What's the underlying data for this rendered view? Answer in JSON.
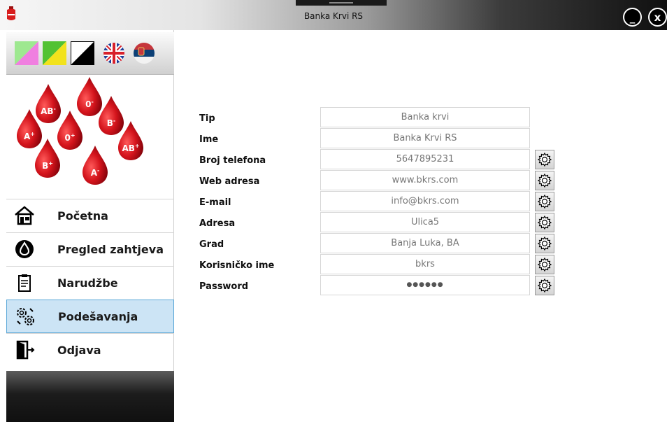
{
  "window": {
    "title": "Banka Krvi RS",
    "minimize_label": "_",
    "close_label": "x"
  },
  "themes": [
    {
      "name": "pink-green-theme",
      "colors": [
        "#f07fe0",
        "#9ee890"
      ]
    },
    {
      "name": "yellow-green-theme",
      "colors": [
        "#f2e21c",
        "#52c232"
      ]
    },
    {
      "name": "black-white-theme",
      "colors": [
        "#000000",
        "#ffffff"
      ]
    }
  ],
  "languages": [
    "english-flag-icon",
    "serbian-flag-icon"
  ],
  "blood_types": [
    "AB-",
    "0-",
    "B-",
    "A+",
    "0+",
    "AB+",
    "B+",
    "A-"
  ],
  "nav": {
    "items": [
      {
        "label": "Početna",
        "icon": "home-icon"
      },
      {
        "label": "Pregled zahtjeva",
        "icon": "blood-drop-icon"
      },
      {
        "label": "Narudžbe",
        "icon": "clipboard-icon"
      },
      {
        "label": "Podešavanja",
        "icon": "settings-icon",
        "selected": true
      },
      {
        "label": "Odjava",
        "icon": "logout-icon"
      }
    ]
  },
  "form": {
    "fields": [
      {
        "label": "Tip",
        "value": "Banka krvi",
        "editable": false
      },
      {
        "label": "Ime",
        "value": "Banka Krvi RS",
        "editable": false
      },
      {
        "label": "Broj telefona",
        "value": "5647895231",
        "editable": true
      },
      {
        "label": "Web adresa",
        "value": "www.bkrs.com",
        "editable": true
      },
      {
        "label": "E-mail",
        "value": "info@bkrs.com",
        "editable": true
      },
      {
        "label": "Adresa",
        "value": "Ulica5",
        "editable": true
      },
      {
        "label": "Grad",
        "value": "Banja Luka, BA",
        "editable": true
      },
      {
        "label": "Korisničko ime",
        "value": "bkrs",
        "editable": true
      },
      {
        "label": "Password",
        "value": "●●●●●●",
        "editable": true
      }
    ]
  }
}
